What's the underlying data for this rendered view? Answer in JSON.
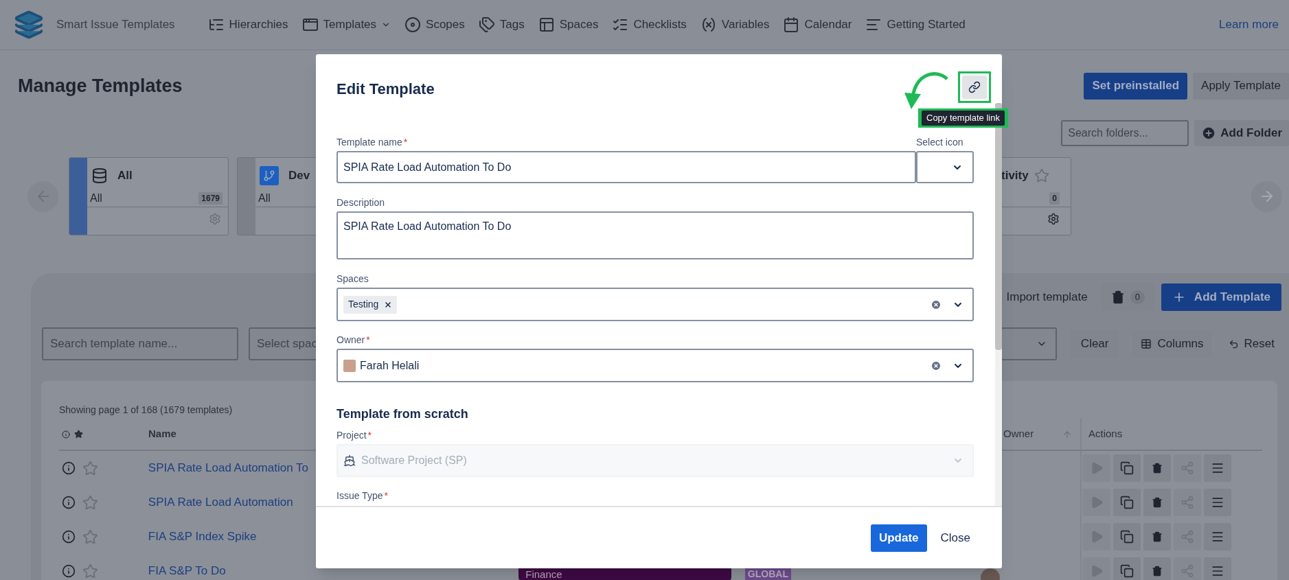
{
  "header": {
    "app_name": "Smart Issue Templates",
    "nav": [
      {
        "label": "Hierarchies",
        "dropdown": false
      },
      {
        "label": "Templates",
        "dropdown": true
      },
      {
        "label": "Scopes",
        "dropdown": false
      },
      {
        "label": "Tags",
        "dropdown": false
      },
      {
        "label": "Spaces",
        "dropdown": false
      },
      {
        "label": "Checklists",
        "dropdown": false
      },
      {
        "label": "Variables",
        "dropdown": false
      },
      {
        "label": "Calendar",
        "dropdown": false
      },
      {
        "label": "Getting Started",
        "dropdown": false
      }
    ],
    "learn_more": "Learn more"
  },
  "page": {
    "title": "Manage Templates",
    "primary_button": "Set preinstalled",
    "secondary_button": "Apply Template",
    "folder_search": {
      "placeholder": "Search folders..."
    },
    "add_folder": "Add Folder"
  },
  "folders": [
    {
      "name": "All",
      "filter": "All",
      "count": "1679",
      "selected": true
    },
    {
      "name": "Dev",
      "filter": "All",
      "selected": false
    },
    {
      "name": "tivity",
      "count": "0",
      "selected": false
    }
  ],
  "toolbar": {
    "import": "Import template",
    "trash_count": "0",
    "add_template": "Add Template"
  },
  "filters": {
    "search": {
      "placeholder": "Search template name..."
    },
    "space": {
      "placeholder": "Select spac"
    },
    "clear": "Clear",
    "columns": "Columns",
    "reset": "Reset"
  },
  "table": {
    "summary": "Showing page 1 of 168 (1679 templates)",
    "columns": {
      "name": "Name",
      "owner": "Owner",
      "actions": "Actions"
    },
    "rows": [
      {
        "name": "SPIA Rate Load Automation To",
        "starred": false
      },
      {
        "name": "SPIA Rate Load Automation",
        "starred": false
      },
      {
        "name": "FIA S&P Index Spike",
        "starred": false
      },
      {
        "name": "FIA S&P To Do",
        "starred": false,
        "category": {
          "label": "Finance",
          "color": "#3f0a45"
        },
        "scope": {
          "label": "GLOBAL",
          "color": "#6e4d8e"
        }
      }
    ]
  },
  "modal": {
    "title": "Edit Template",
    "tooltip": "Copy template link",
    "required_mark": "*",
    "template_name": {
      "label": "Template name",
      "required": true,
      "value": "SPIA Rate Load Automation To Do"
    },
    "select_icon": {
      "label": "Select icon",
      "required": false
    },
    "description": {
      "label": "Description",
      "required": false,
      "value": "SPIA Rate Load Automation To Do"
    },
    "spaces": {
      "label": "Spaces",
      "required": false,
      "chips": [
        "Testing"
      ]
    },
    "owner": {
      "label": "Owner",
      "required": true,
      "value": "Farah Helali"
    },
    "section": "Template from scratch",
    "project": {
      "label": "Project",
      "required": true,
      "value": "Software Project (SP)",
      "disabled": true
    },
    "issue_type": {
      "label": "Issue Type",
      "required": true
    },
    "update": "Update",
    "close": "Close"
  }
}
